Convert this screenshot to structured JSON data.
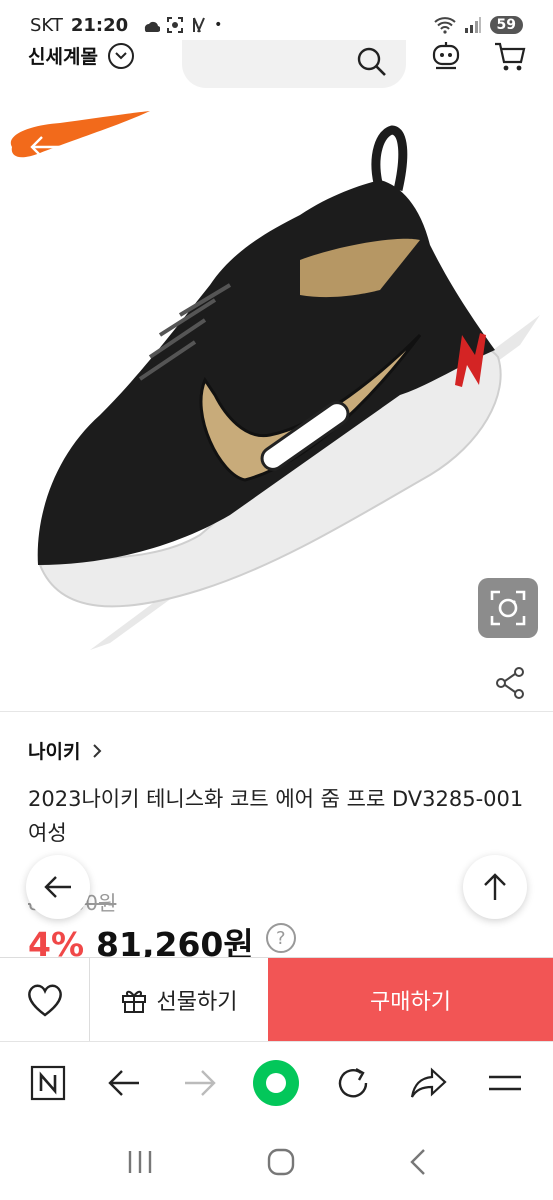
{
  "status_bar": {
    "carrier": "SKT",
    "time": "21:20",
    "battery": "59"
  },
  "header": {
    "brand": "신세계몰"
  },
  "product": {
    "brand": "나이키",
    "title": "2023나이키 테니스화 코트 에어 줌 프로 DV3285-001 여성",
    "original_price": "84,900원",
    "discount": "4%",
    "sale_price": "81,260원",
    "image_badge": "N"
  },
  "purchase_bar": {
    "gift_label": "선물하기",
    "buy_label": "구매하기"
  },
  "colors": {
    "accent": "#f25555",
    "discount": "#f04848",
    "nike_orange": "#f26a1b",
    "shoe_black": "#1c1c1c",
    "shoe_gold": "#c8ab7a",
    "browser_green": "#03c75a"
  },
  "icons": {
    "search": "search-icon",
    "bell": "notification-icon",
    "cart": "cart-icon",
    "share": "share-icon",
    "lens": "image-search-icon",
    "heart": "heart-icon",
    "gift": "gift-icon"
  }
}
